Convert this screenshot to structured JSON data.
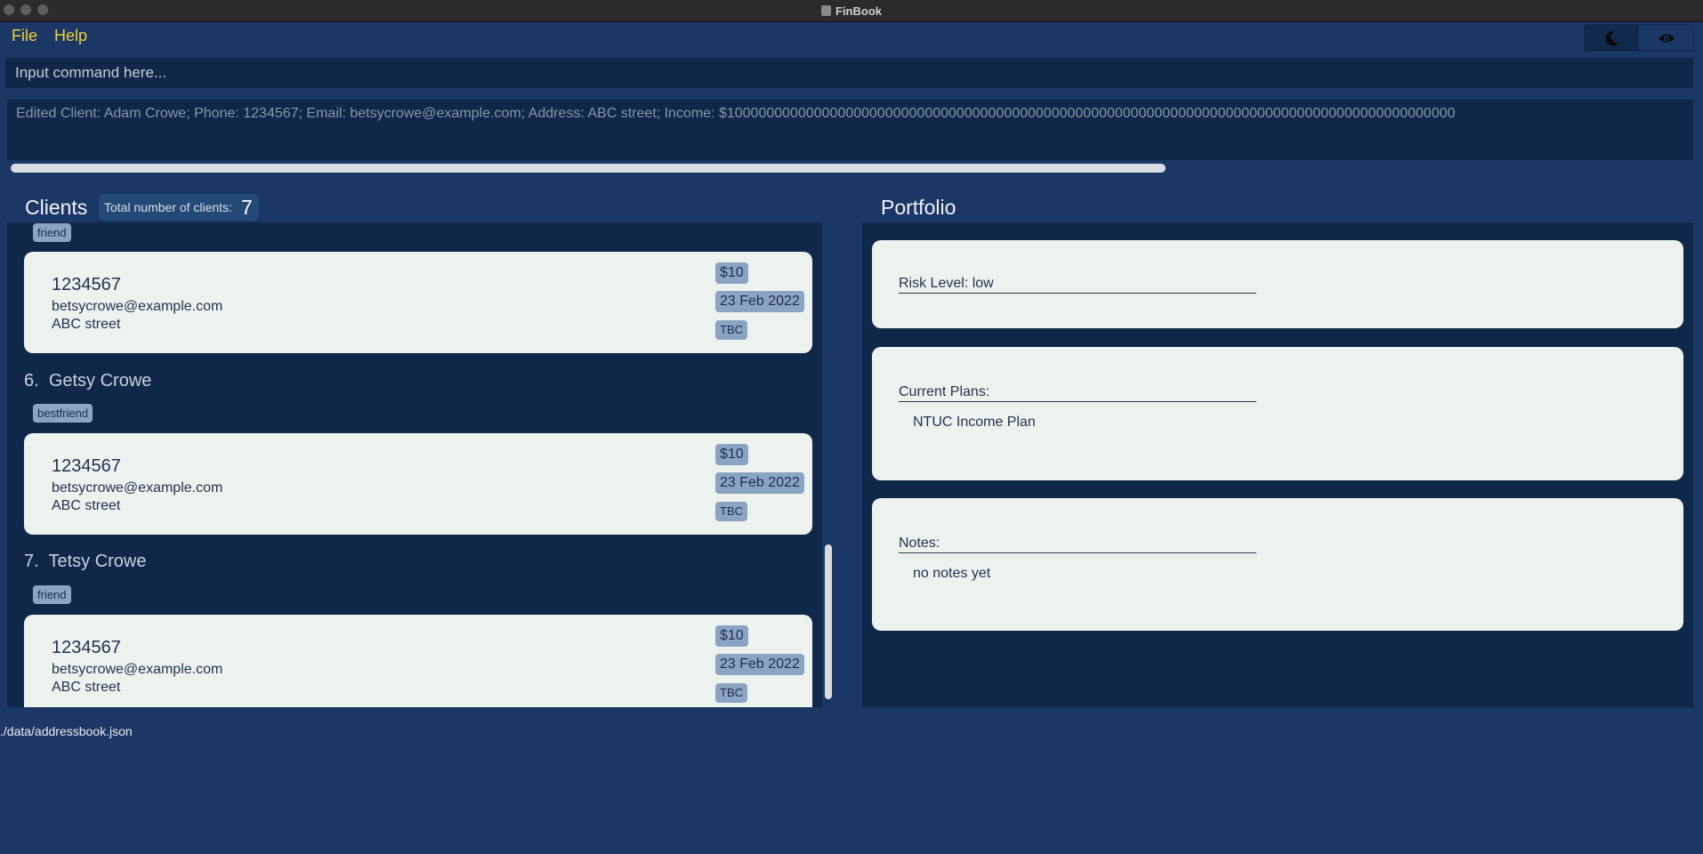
{
  "window": {
    "title": "FinBook"
  },
  "menu": {
    "file": "File",
    "help": "Help"
  },
  "theme_toggle": {
    "dark_icon": "moon-icon",
    "privacy_icon": "eye-icon",
    "active": "dark"
  },
  "command": {
    "placeholder": "Input command here..."
  },
  "result": {
    "text": "Edited Client: Adam Crowe; Phone: 1234567; Email: betsycrowe@example.com; Address: ABC street; Income: $10000000000000000000000000000000000000000000000000000000000000000000000000000000000000000000"
  },
  "clients": {
    "title": "Clients",
    "total_label": "Total number of clients:",
    "total": "7",
    "partial_tag": "friend",
    "items": [
      {
        "phone": "1234567",
        "email": "betsycrowe@example.com",
        "address": "ABC street",
        "income": "$10",
        "date": "23 Feb 2022",
        "status": "TBC"
      },
      {
        "index": "6.",
        "name": "Getsy Crowe",
        "tag": "bestfriend",
        "phone": "1234567",
        "email": "betsycrowe@example.com",
        "address": "ABC street",
        "income": "$10",
        "date": "23 Feb 2022",
        "status": "TBC"
      },
      {
        "index": "7.",
        "name": "Tetsy Crowe",
        "tag": "friend",
        "phone": "1234567",
        "email": "betsycrowe@example.com",
        "address": "ABC street",
        "income": "$10",
        "date": "23 Feb 2022",
        "status": "TBC"
      }
    ]
  },
  "portfolio": {
    "title": "Portfolio",
    "risk": "Risk Level: low",
    "plans_label": "Current Plans:",
    "plans_value": "NTUC Income Plan",
    "notes_label": "Notes:",
    "notes_value": "no notes yet"
  },
  "status": {
    "path": "./data/addressbook.json"
  },
  "colors": {
    "background": "#1b3766",
    "panel": "#0f2849",
    "menu_text": "#f2d23a",
    "card": "#eef2ee",
    "tag": "#8ca4c3"
  }
}
